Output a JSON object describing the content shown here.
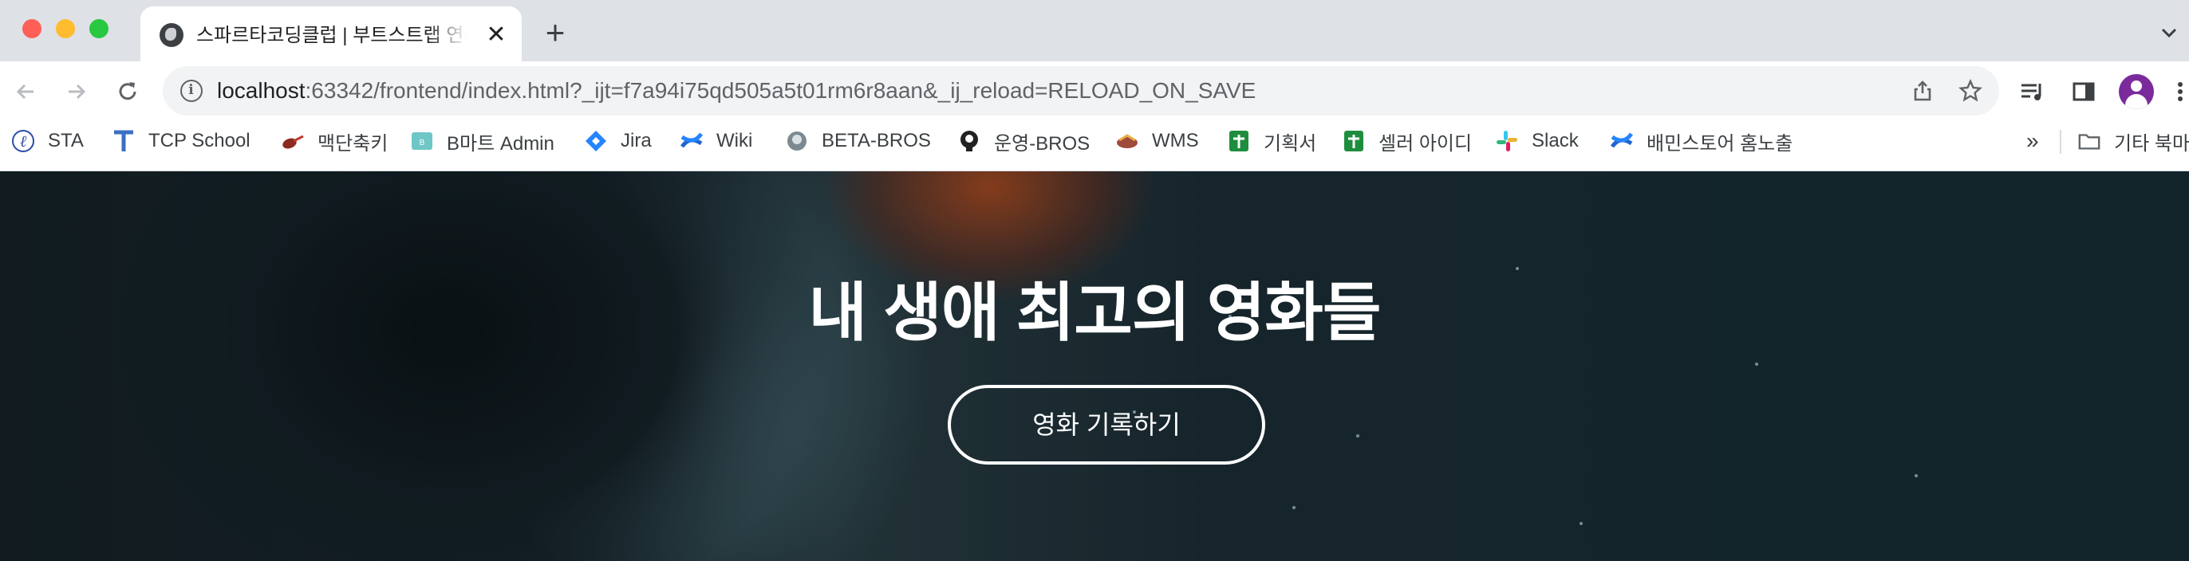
{
  "window": {
    "traffic_lights": [
      "#ff5f57",
      "#febc2e",
      "#28c840"
    ]
  },
  "tab": {
    "title": "스파르타코딩클럽 | 부트스트랩 연습하기",
    "favicon": "globe-icon"
  },
  "toolbar": {
    "url_host": "localhost",
    "url_path": ":63342/frontend/index.html?_ijt=f7a94i75qd505a5t01rm6r8aan&_ij_reload=RELOAD_ON_SAVE"
  },
  "bookmarks": {
    "items": [
      {
        "label": "STA",
        "icon": "sta-logo-icon"
      },
      {
        "label": "TCP School",
        "icon": "tcp-school-icon"
      },
      {
        "label": "맥단축키",
        "icon": "guitar-icon"
      },
      {
        "label": "B마트 Admin",
        "icon": "bmart-icon"
      },
      {
        "label": "Jira",
        "icon": "jira-icon"
      },
      {
        "label": "Wiki",
        "icon": "confluence-icon"
      },
      {
        "label": "BETA-BROS",
        "icon": "bros-icon"
      },
      {
        "label": "운영-BROS",
        "icon": "bros-dark-icon"
      },
      {
        "label": "WMS",
        "icon": "wms-icon"
      },
      {
        "label": "기획서",
        "icon": "sheets-icon"
      },
      {
        "label": "셀러 아이디",
        "icon": "sheets-icon"
      },
      {
        "label": "Slack",
        "icon": "slack-icon"
      },
      {
        "label": "배민스토어 홈노출",
        "icon": "confluence-icon"
      }
    ],
    "overflow": "»",
    "other_folder": "기타 북마크"
  },
  "hero": {
    "title": "내 생애 최고의 영화들",
    "button_label": "영화 기록하기"
  }
}
